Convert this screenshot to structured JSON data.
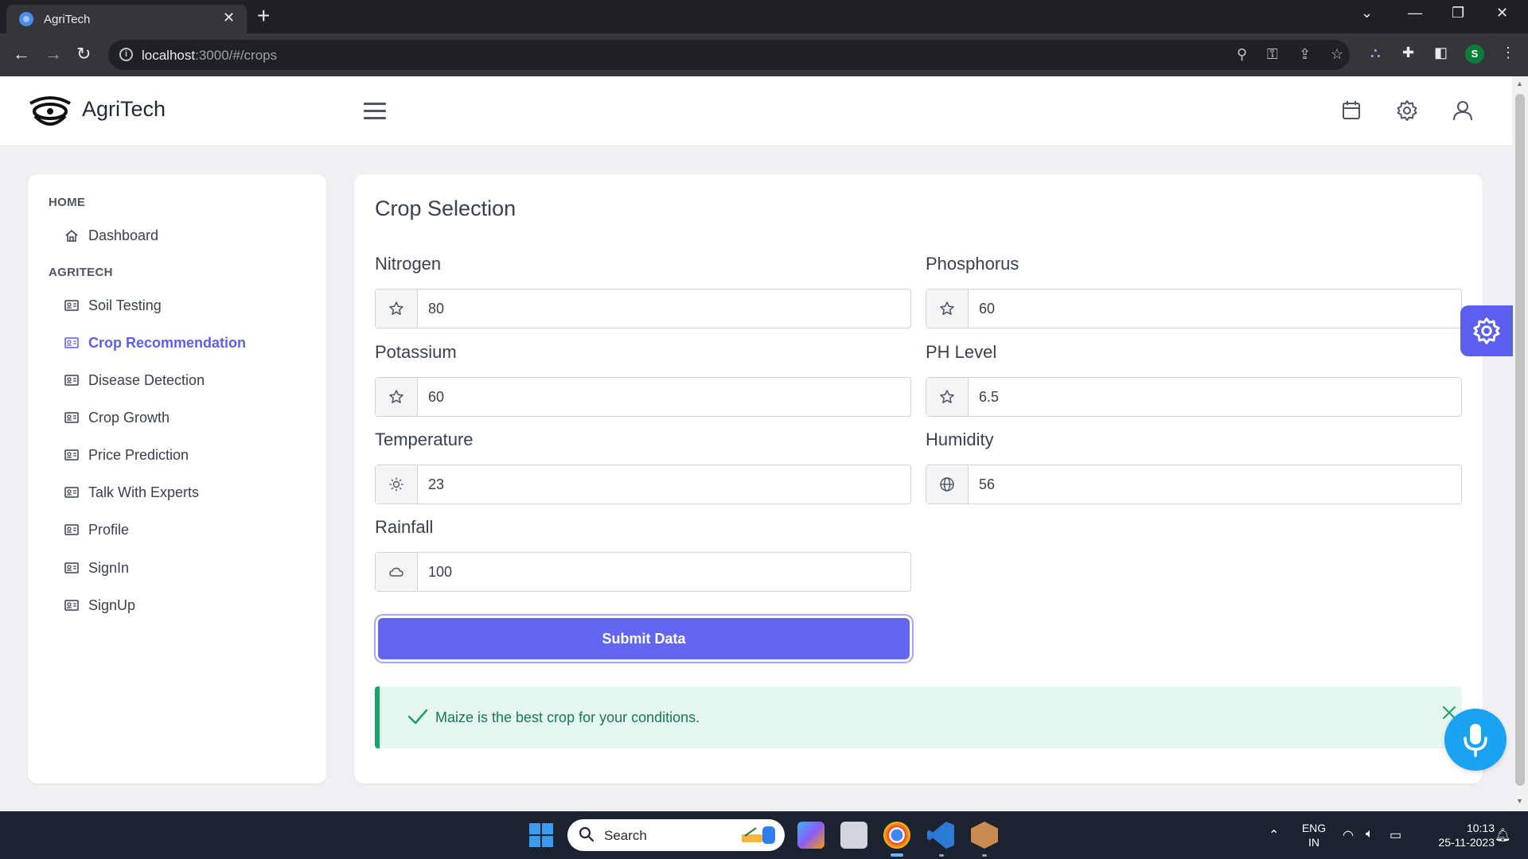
{
  "browser": {
    "tab_title": "AgriTech",
    "url_host": "localhost",
    "url_path": ":3000/#/crops",
    "profile_initial": "S"
  },
  "header": {
    "brand": "AgriTech"
  },
  "sidebar": {
    "sections": [
      {
        "title": "HOME",
        "items": [
          {
            "label": "Dashboard",
            "icon": "home-icon"
          }
        ]
      },
      {
        "title": "AGRITECH",
        "items": [
          {
            "label": "Soil Testing",
            "icon": "id-card-icon"
          },
          {
            "label": "Crop Recommendation",
            "icon": "id-card-icon",
            "active": true
          },
          {
            "label": "Disease Detection",
            "icon": "id-card-icon"
          },
          {
            "label": "Crop Growth",
            "icon": "id-card-icon"
          },
          {
            "label": "Price Prediction",
            "icon": "id-card-icon"
          },
          {
            "label": "Talk With Experts",
            "icon": "id-card-icon"
          },
          {
            "label": "Profile",
            "icon": "id-card-icon"
          },
          {
            "label": "SignIn",
            "icon": "id-card-icon"
          },
          {
            "label": "SignUp",
            "icon": "id-card-icon"
          }
        ]
      }
    ]
  },
  "form": {
    "title": "Crop Selection",
    "fields": {
      "nitrogen": {
        "label": "Nitrogen",
        "value": "80",
        "icon": "star-icon"
      },
      "phosphorus": {
        "label": "Phosphorus",
        "value": "60",
        "icon": "star-icon"
      },
      "potassium": {
        "label": "Potassium",
        "value": "60",
        "icon": "star-icon"
      },
      "ph": {
        "label": "PH Level",
        "value": "6.5",
        "icon": "star-icon"
      },
      "temperature": {
        "label": "Temperature",
        "value": "23",
        "icon": "sun-icon"
      },
      "humidity": {
        "label": "Humidity",
        "value": "56",
        "icon": "globe-icon"
      },
      "rainfall": {
        "label": "Rainfall",
        "value": "100",
        "icon": "cloud-icon"
      }
    },
    "submit_label": "Submit Data",
    "result_message": "Maize is the best crop for your conditions."
  },
  "taskbar": {
    "search_label": "Search",
    "lang_line1": "ENG",
    "lang_line2": "IN",
    "time": "10:13",
    "date": "25-11-2023"
  },
  "colors": {
    "accent": "#6366f1",
    "active_nav": "#5b5fef",
    "success_bg": "#e6f7ef",
    "success_border": "#16a36a",
    "mic_button": "#1aa3f0"
  }
}
